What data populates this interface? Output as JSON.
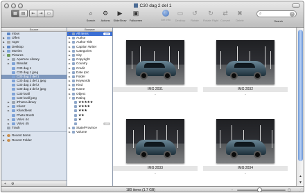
{
  "window": {
    "title": "C30 dag 2 del 1"
  },
  "toolbar": {
    "view_buttons": [
      "▦",
      "▤",
      "⇤",
      "⇥",
      "▭"
    ],
    "items": [
      {
        "label": "Search",
        "icon": "magnifier-icon",
        "glyph": "⌕"
      },
      {
        "label": "Actions",
        "icon": "gear-icon",
        "glyph": "⚙"
      },
      {
        "label": "SlideShow",
        "icon": "slideshow-icon",
        "glyph": "▶"
      },
      {
        "label": "Fullscreen",
        "icon": "fullscreen-icon",
        "glyph": "▣"
      },
      {
        "label": "Get Info",
        "icon": "info-icon",
        "glyph": "i"
      },
      {
        "label": "Desktop",
        "icon": "desktop-icon",
        "glyph": "▭"
      },
      {
        "label": "Rotate",
        "icon": "rotate-left-icon",
        "glyph": "↺"
      },
      {
        "label": "Rotate Right",
        "icon": "rotate-right-icon",
        "glyph": "↻"
      },
      {
        "label": "Convert",
        "icon": "convert-icon",
        "glyph": "⇄"
      },
      {
        "label": "Delete",
        "icon": "trash-icon",
        "glyph": "✖"
      }
    ],
    "search_label": "Search",
    "search_placeholder": ""
  },
  "source": {
    "header": "Source",
    "items": [
      {
        "label": "mbus",
        "level": 0,
        "icon": "blue",
        "tri": ""
      },
      {
        "label": "Offert",
        "level": 0,
        "icon": "folder",
        "tri": "▶"
      },
      {
        "label": "roger",
        "level": 0,
        "icon": "drive",
        "tri": "▶"
      },
      {
        "label": "Desktop",
        "level": 0,
        "icon": "blue",
        "tri": "▶"
      },
      {
        "label": "Movies",
        "level": 0,
        "icon": "folder",
        "tri": "▶"
      },
      {
        "label": "Pictures",
        "level": 0,
        "icon": "pics",
        "tri": "▼"
      },
      {
        "label": "Aperture Library",
        "level": 1,
        "icon": "gray",
        "tri": "▶"
      },
      {
        "label": "Blandat",
        "level": 1,
        "icon": "folder",
        "tri": "▶"
      },
      {
        "label": "C30 dag 1",
        "level": 1,
        "icon": "folder",
        "tri": ""
      },
      {
        "label": "C30 dag 1 jpeg",
        "level": 1,
        "icon": "folder",
        "tri": ""
      },
      {
        "label": "C30 dag 2 del 1",
        "level": 1,
        "icon": "folder",
        "tri": "",
        "selected": true
      },
      {
        "label": "C30 dag 2 del 1 jpeg",
        "level": 1,
        "icon": "folder",
        "tri": ""
      },
      {
        "label": "C30 dag 2 del 2",
        "level": 1,
        "icon": "folder",
        "tri": ""
      },
      {
        "label": "C30 dag 2 del 2 jpeg",
        "level": 1,
        "icon": "folder",
        "tri": ""
      },
      {
        "label": "C30 kvall",
        "level": 1,
        "icon": "folder",
        "tri": ""
      },
      {
        "label": "C30 kvall jpeg",
        "level": 1,
        "icon": "folder",
        "tri": ""
      },
      {
        "label": "iPhoto Library",
        "level": 1,
        "icon": "gray",
        "tri": "▶"
      },
      {
        "label": "Kilanz",
        "level": 1,
        "icon": "folder",
        "tri": "▶"
      },
      {
        "label": "Kilandbeat",
        "level": 1,
        "icon": "folder",
        "tri": "▶"
      },
      {
        "label": "Photo Booth",
        "level": 1,
        "icon": "folder",
        "tri": ""
      },
      {
        "label": "Volvo 44",
        "level": 1,
        "icon": "folder",
        "tri": "▶"
      },
      {
        "label": "Volvo 45",
        "level": 1,
        "icon": "folder",
        "tri": "▶"
      },
      {
        "label": "Trash",
        "level": 0,
        "icon": "gray",
        "tri": ""
      }
    ],
    "recent": [
      {
        "label": "Recent Items",
        "tri": "▶"
      },
      {
        "label": "Recent Folder",
        "tri": "▶"
      }
    ],
    "bottom_icons": [
      "+",
      "⚙"
    ]
  },
  "smart": {
    "header": "Browser",
    "items": [
      {
        "label": "All Items",
        "tri": "▼",
        "badge": "180",
        "selected": true
      },
      {
        "label": "Author",
        "tri": "▶"
      },
      {
        "label": "Author Title",
        "tri": "▶"
      },
      {
        "label": "Caption Writer",
        "tri": "▶"
      },
      {
        "label": "Categories",
        "tri": "▶"
      },
      {
        "label": "City",
        "tri": "▶"
      },
      {
        "label": "Copyright",
        "tri": "▶"
      },
      {
        "label": "Country",
        "tri": "▶"
      },
      {
        "label": "Credit",
        "tri": "▶"
      },
      {
        "label": "Date Iptc",
        "tri": "▶"
      },
      {
        "label": "Folder",
        "tri": "▶"
      },
      {
        "label": "Keywords",
        "tri": "▶"
      },
      {
        "label": "Kind",
        "tri": "▶"
      },
      {
        "label": "Name",
        "tri": "▶"
      },
      {
        "label": "Object",
        "tri": "▶"
      },
      {
        "label": "Rating",
        "tri": "▼"
      }
    ],
    "ratings": [
      {
        "stars": "★★★★★",
        "badge": ""
      },
      {
        "stars": "★★★★",
        "badge": ""
      },
      {
        "stars": "★★★",
        "badge": ""
      },
      {
        "stars": "★★",
        "badge": ""
      },
      {
        "stars": "★",
        "badge": ""
      },
      {
        "stars": "",
        "badge": "180"
      }
    ],
    "tail": [
      {
        "label": "State/Province",
        "tri": "▶"
      },
      {
        "label": "Volume",
        "tri": "▶"
      }
    ]
  },
  "browser": {
    "photos": [
      {
        "name": "IMG 2031"
      },
      {
        "name": "IMG 2032"
      },
      {
        "name": "IMG 2033"
      },
      {
        "name": "IMG 2034"
      }
    ],
    "dash": "-"
  },
  "status": {
    "count": "180 items (1.7 GB)",
    "zoom_fraction": 0.46,
    "small": "▫",
    "big": "▢",
    "resize": "⋰"
  }
}
